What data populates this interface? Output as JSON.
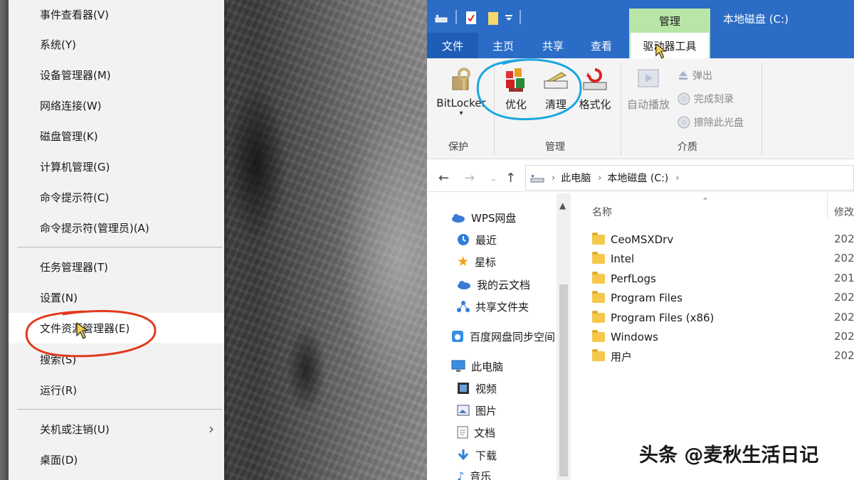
{
  "context_menu": {
    "items": [
      {
        "label": "事件查看器(V)"
      },
      {
        "label": "系统(Y)"
      },
      {
        "label": "设备管理器(M)"
      },
      {
        "label": "网络连接(W)"
      },
      {
        "label": "磁盘管理(K)"
      },
      {
        "label": "计算机管理(G)"
      },
      {
        "label": "命令提示符(C)"
      },
      {
        "label": "命令提示符(管理员)(A)"
      },
      {
        "label": "任务管理器(T)"
      },
      {
        "label": "设置(N)"
      },
      {
        "label": "文件资源管理器(E)"
      },
      {
        "label": "搜索(S)"
      },
      {
        "label": "运行(R)"
      },
      {
        "label": "关机或注销(U)"
      },
      {
        "label": "桌面(D)"
      }
    ],
    "submenu_chevron": "›"
  },
  "explorer": {
    "context_tab_group": "管理",
    "title": "本地磁盘 (C:)",
    "tabs": {
      "file": "文件",
      "home": "主页",
      "share": "共享",
      "view": "查看",
      "drive_tools": "驱动器工具"
    },
    "ribbon": {
      "protect": {
        "bitlocker": "BitLocker",
        "group": "保护"
      },
      "manage": {
        "optimize": "优化",
        "cleanup": "清理",
        "format": "格式化",
        "group": "管理"
      },
      "media": {
        "autoplay": "自动播放",
        "eject": "弹出",
        "finish_burn": "完成刻录",
        "erase_disc": "擦除此光盘",
        "group": "介质"
      }
    },
    "address": {
      "crumbs": [
        "此电脑",
        "本地磁盘 (C:)"
      ]
    },
    "nav_pane": {
      "items": [
        {
          "label": "WPS网盘"
        },
        {
          "label": "最近"
        },
        {
          "label": "星标"
        },
        {
          "label": "我的云文档"
        },
        {
          "label": "共享文件夹"
        },
        {
          "label": "百度网盘同步空间"
        },
        {
          "label": "此电脑"
        },
        {
          "label": "视频"
        },
        {
          "label": "图片"
        },
        {
          "label": "文档"
        },
        {
          "label": "下载"
        },
        {
          "label": "音乐"
        }
      ]
    },
    "file_list": {
      "columns": {
        "name": "名称",
        "modified": "修改"
      },
      "rows": [
        {
          "name": "CeoMSXDrv",
          "date": "202"
        },
        {
          "name": "Intel",
          "date": "202"
        },
        {
          "name": "PerfLogs",
          "date": "201"
        },
        {
          "name": "Program Files",
          "date": "202"
        },
        {
          "name": "Program Files (x86)",
          "date": "202"
        },
        {
          "name": "Windows",
          "date": "202"
        },
        {
          "name": "用户",
          "date": "202"
        }
      ]
    }
  },
  "watermark": "头条 @麦秋生活日记",
  "colors": {
    "accent_blue": "#2b6cc6",
    "context_tab_green": "#b9e6a6",
    "annotation_blue": "#1aa7e0",
    "annotation_red": "#e23a1e",
    "folder_yellow": "#f5c84c"
  }
}
